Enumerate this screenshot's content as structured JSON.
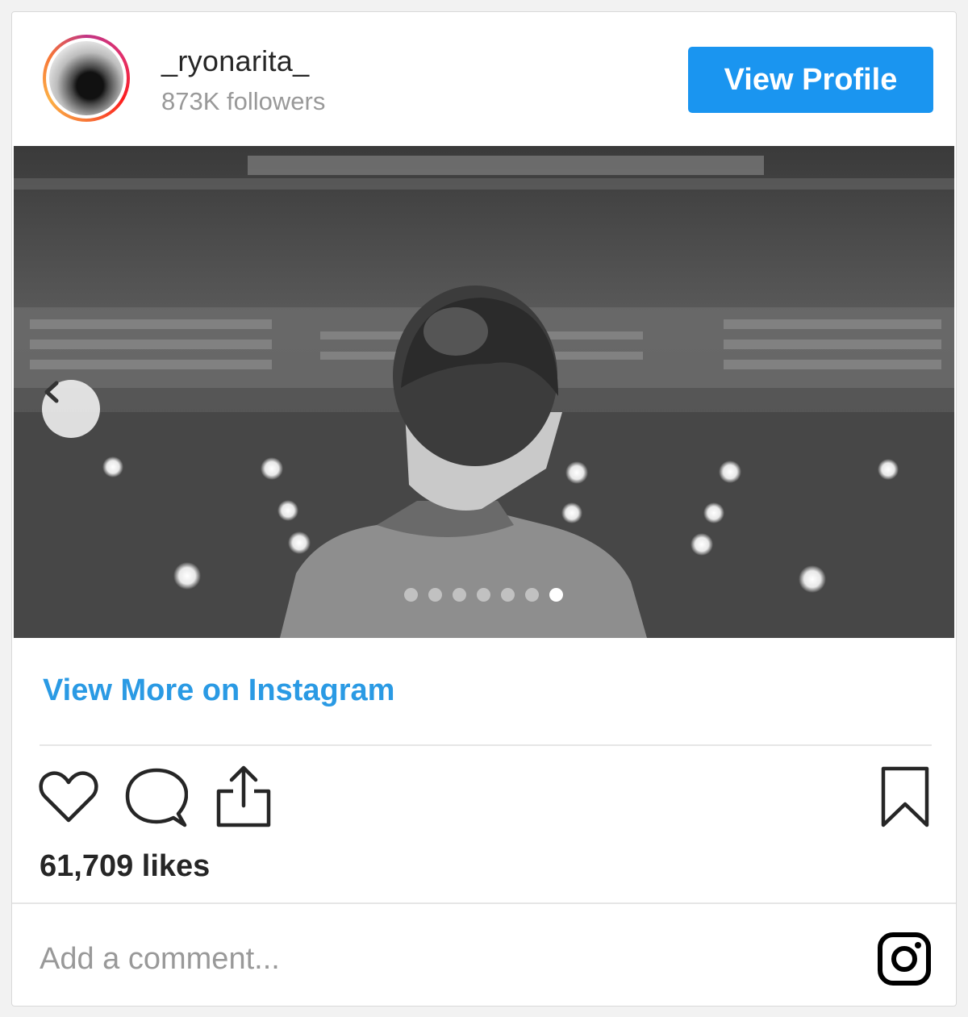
{
  "post": {
    "username": "_ryonarita_",
    "followers": "873K followers",
    "view_profile_label": "View Profile",
    "view_more_label": "View More on Instagram",
    "likes": "61,709 likes",
    "comment_placeholder": "Add a comment...",
    "carousel": {
      "slide_count": 7,
      "active_index": 6
    }
  },
  "icons": {
    "like": "heart-icon",
    "comment": "comment-bubble-icon",
    "share": "share-icon",
    "save": "bookmark-icon",
    "logo": "instagram-icon",
    "prev": "chevron-left-icon"
  },
  "colors": {
    "accent": "#1a95f0",
    "link": "#2a9ae4"
  }
}
